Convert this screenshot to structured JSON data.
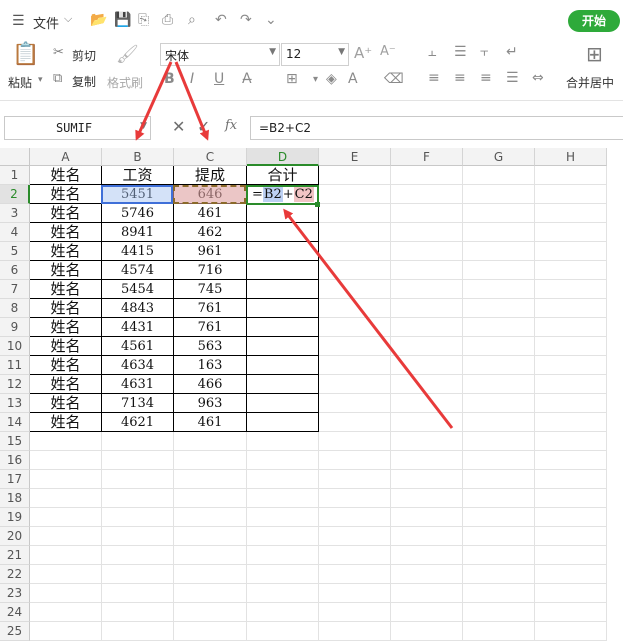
{
  "menubar": {
    "file_label": "文件",
    "start_label": "开始"
  },
  "ribbon": {
    "cut_label": "剪切",
    "copy_label": "复制",
    "paste_label": "粘贴",
    "format_painter_label": "格式刷",
    "font_name": "宋体",
    "font_size": "12",
    "merge_center_label": "合并居中"
  },
  "formula_bar": {
    "name_box": "SUMIF",
    "fx_label": "fx",
    "formula": "=B2+C2"
  },
  "sheet": {
    "columns": [
      "A",
      "B",
      "C",
      "D",
      "E",
      "F",
      "G",
      "H"
    ],
    "active_column": "D",
    "active_row": "2",
    "rows": [
      "1",
      "2",
      "3",
      "4",
      "5",
      "6",
      "7",
      "8",
      "9",
      "10",
      "11",
      "12",
      "13",
      "14",
      "15",
      "16",
      "17",
      "18",
      "19",
      "20",
      "21",
      "22",
      "23",
      "24",
      "25"
    ],
    "header": [
      "姓名",
      "工资",
      "提成",
      "合计"
    ],
    "data": [
      [
        "姓名",
        "5451",
        "646"
      ],
      [
        "姓名",
        "5746",
        "461"
      ],
      [
        "姓名",
        "8941",
        "462"
      ],
      [
        "姓名",
        "4415",
        "961"
      ],
      [
        "姓名",
        "4574",
        "716"
      ],
      [
        "姓名",
        "5454",
        "745"
      ],
      [
        "姓名",
        "4843",
        "761"
      ],
      [
        "姓名",
        "4431",
        "761"
      ],
      [
        "姓名",
        "4561",
        "563"
      ],
      [
        "姓名",
        "4634",
        "163"
      ],
      [
        "姓名",
        "4631",
        "466"
      ],
      [
        "姓名",
        "7134",
        "963"
      ],
      [
        "姓名",
        "4621",
        "461"
      ]
    ],
    "editing_cell": {
      "eq": "=",
      "ref1": "B2",
      "op": "+",
      "ref2": "C2"
    }
  },
  "colors": {
    "accent": "#2eaa3a",
    "arrow": "#e83a3a",
    "ref1_highlight": "#bcd0f3",
    "ref2_highlight": "#f1c4c4"
  }
}
